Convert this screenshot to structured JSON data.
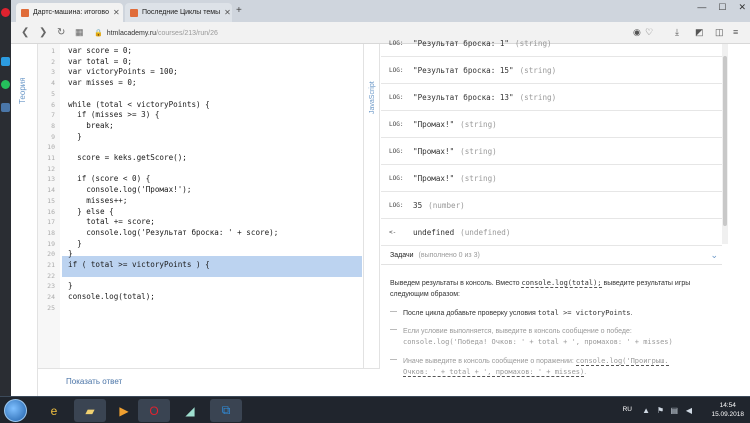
{
  "browser": {
    "tabs": [
      {
        "title": "Дартс-машина: итогово",
        "active": true
      },
      {
        "title": "Последние Циклы темы",
        "active": false
      }
    ],
    "new_tab": "+",
    "window_controls": [
      "—",
      "☐",
      "✕"
    ],
    "url_host": "htmlacademy.ru",
    "url_path": "/courses/213/run/26"
  },
  "editor": {
    "theory_label": "Теория",
    "js_label": "JavaScript",
    "lines": [
      {
        "n": "1",
        "text": "var score = 0;"
      },
      {
        "n": "2",
        "text": "var total = 0;"
      },
      {
        "n": "3",
        "text": "var victoryPoints = 100;"
      },
      {
        "n": "4",
        "text": "var misses = 0;"
      },
      {
        "n": "5",
        "text": ""
      },
      {
        "n": "6",
        "text": "while (total < victoryPoints) {"
      },
      {
        "n": "7",
        "text": "  if (misses >= 3) {"
      },
      {
        "n": "8",
        "text": "    break;"
      },
      {
        "n": "9",
        "text": "  }"
      },
      {
        "n": "10",
        "text": ""
      },
      {
        "n": "11",
        "text": "  score = keks.getScore();"
      },
      {
        "n": "12",
        "text": ""
      },
      {
        "n": "13",
        "text": "  if (score < 0) {"
      },
      {
        "n": "14",
        "text": "    console.log('Промах!');"
      },
      {
        "n": "15",
        "text": "    misses++;"
      },
      {
        "n": "16",
        "text": "  } else {"
      },
      {
        "n": "17",
        "text": "    total += score;"
      },
      {
        "n": "18",
        "text": "    console.log('Результат броска: ' + score);"
      },
      {
        "n": "19",
        "text": "  }"
      },
      {
        "n": "20",
        "text": "}"
      },
      {
        "n": "21",
        "text": "if ( total >= victoryPoints ) {"
      },
      {
        "n": "22",
        "text": ""
      },
      {
        "n": "23",
        "text": "}"
      },
      {
        "n": "24",
        "text": "console.log(total);"
      },
      {
        "n": "25",
        "text": ""
      }
    ],
    "show_answer": "Показать ответ"
  },
  "console": {
    "rows": [
      {
        "tag": "LOG:",
        "value": "\"Результат броска: 1\"",
        "type": "(string)"
      },
      {
        "tag": "LOG:",
        "value": "\"Результат броска: 15\"",
        "type": "(string)"
      },
      {
        "tag": "LOG:",
        "value": "\"Результат броска: 13\"",
        "type": "(string)"
      },
      {
        "tag": "LOG:",
        "value": "\"Промах!\"",
        "type": "(string)"
      },
      {
        "tag": "LOG:",
        "value": "\"Промах!\"",
        "type": "(string)"
      },
      {
        "tag": "LOG:",
        "value": "\"Промах!\"",
        "type": "(string)"
      },
      {
        "tag": "LOG:",
        "value": "35",
        "type": "(number)"
      },
      {
        "tag": "<-",
        "value": "undefined",
        "type": "(undefined)"
      }
    ]
  },
  "tasks": {
    "title": "Задачи",
    "count": "(выполнено 0 из 3)",
    "intro_a": "Выведем результаты в консоль. Вместо",
    "intro_code": "console.log(total);",
    "intro_b": "выведите результаты",
    "intro_c": "игры следующим образом:",
    "t1_a": "После цикла добавьте проверку условия",
    "t1_code": "total >= victoryPoints",
    "t1_b": ".",
    "t2_a": "Если условие выполняется, выведите в консоль сообщение о победе:",
    "t2_code": "console.log('Победа! Очков: ' + total + ', промахов: ' + misses)",
    "t3_a": "Иначе выведите в консоль сообщение о поражении:",
    "t3_code1": "console.log('Проигрыш.",
    "t3_code2": "Очков: ' + total + ', промахов: ' + misses)",
    "t3_b": "."
  },
  "taskbar": {
    "lang": "RU",
    "time": "14:54",
    "date": "15.09.2018"
  },
  "colors": {
    "highlight": "#bcd3f0",
    "link": "#4a74a7",
    "taskbar": "#20252d",
    "opera_red": "#e0222f"
  }
}
